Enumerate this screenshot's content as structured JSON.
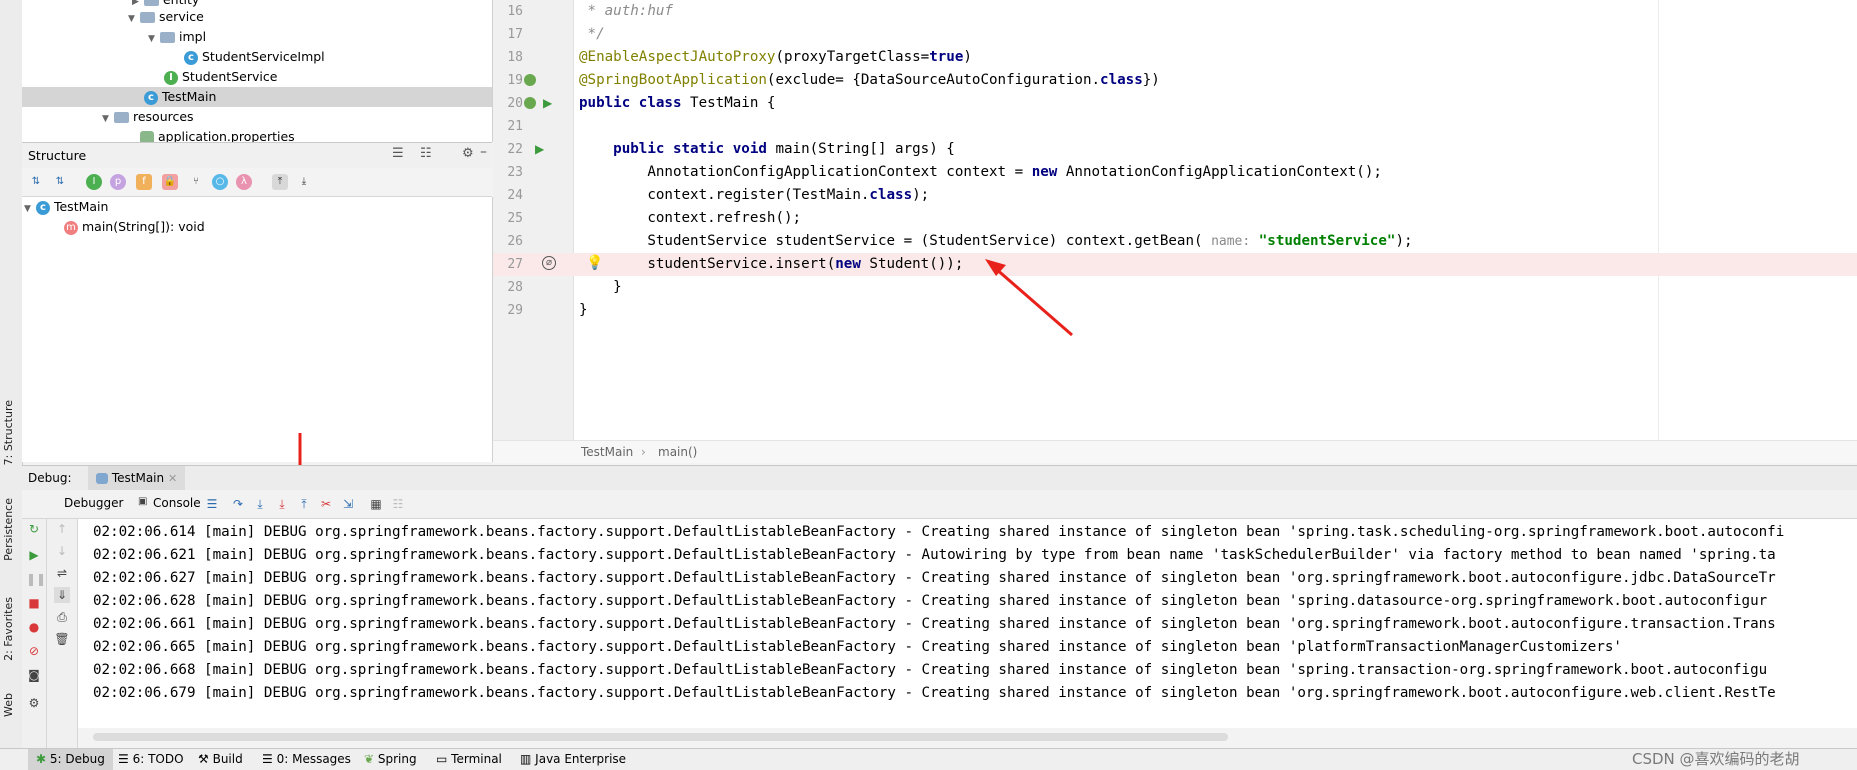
{
  "project_tree": {
    "items": [
      {
        "label": "entity",
        "icon": "folder-icon"
      },
      {
        "label": "service",
        "icon": "folder-icon"
      },
      {
        "label": "impl",
        "icon": "folder-icon"
      },
      {
        "label": "StudentServiceImpl",
        "icon": "class-icon"
      },
      {
        "label": "StudentService",
        "icon": "interface-icon"
      },
      {
        "label": "TestMain",
        "icon": "class-icon"
      },
      {
        "label": "resources",
        "icon": "folder-icon"
      },
      {
        "label": "application.properties",
        "icon": "properties-icon"
      }
    ]
  },
  "structure": {
    "title": "Structure",
    "root": "TestMain",
    "method": "main(String[]): void"
  },
  "editor": {
    "lines": [
      {
        "num": "16",
        "text": " * auth:huf"
      },
      {
        "num": "17",
        "text": " */"
      },
      {
        "num": "18",
        "text": "@EnableAspectJAutoProxy(proxyTargetClass=true)"
      },
      {
        "num": "19",
        "text": "@SpringBootApplication(exclude= {DataSourceAutoConfiguration.class})"
      },
      {
        "num": "20",
        "text": "public class TestMain {"
      },
      {
        "num": "21",
        "text": ""
      },
      {
        "num": "22",
        "text": "    public static void main(String[] args) {"
      },
      {
        "num": "23",
        "text": "        AnnotationConfigApplicationContext context = new AnnotationConfigApplicationContext();"
      },
      {
        "num": "24",
        "text": "        context.register(TestMain.class);"
      },
      {
        "num": "25",
        "text": "        context.refresh();"
      },
      {
        "num": "26",
        "text": "        StudentService studentService = (StudentService) context.getBean( name: \"studentService\");"
      },
      {
        "num": "27",
        "text": "        studentService.insert(new Student());"
      },
      {
        "num": "28",
        "text": "    }"
      },
      {
        "num": "29",
        "text": "}"
      }
    ],
    "breadcrumb": [
      "TestMain",
      "main()"
    ]
  },
  "debug": {
    "label": "Debug:",
    "session_tab": "TestMain",
    "tabs": [
      "Debugger",
      "Console"
    ]
  },
  "console": {
    "lines": [
      "02:02:06.614 [main] DEBUG org.springframework.beans.factory.support.DefaultListableBeanFactory - Creating shared instance of singleton bean 'spring.task.scheduling-org.springframework.boot.autoconfi",
      "02:02:06.621 [main] DEBUG org.springframework.beans.factory.support.DefaultListableBeanFactory - Autowiring by type from bean name 'taskSchedulerBuilder' via factory method to bean named 'spring.ta",
      "02:02:06.627 [main] DEBUG org.springframework.beans.factory.support.DefaultListableBeanFactory - Creating shared instance of singleton bean 'org.springframework.boot.autoconfigure.jdbc.DataSourceTr",
      "02:02:06.628 [main] DEBUG org.springframework.beans.factory.support.DefaultListableBeanFactory - Creating shared instance of singleton bean 'spring.datasource-org.springframework.boot.autoconfigur",
      "02:02:06.661 [main] DEBUG org.springframework.beans.factory.support.DefaultListableBeanFactory - Creating shared instance of singleton bean 'org.springframework.boot.autoconfigure.transaction.Trans",
      "02:02:06.665 [main] DEBUG org.springframework.beans.factory.support.DefaultListableBeanFactory - Creating shared instance of singleton bean 'platformTransactionManagerCustomizers'",
      "02:02:06.668 [main] DEBUG org.springframework.beans.factory.support.DefaultListableBeanFactory - Creating shared instance of singleton bean 'spring.transaction-org.springframework.boot.autoconfigu",
      "02:02:06.679 [main] DEBUG org.springframework.beans.factory.support.DefaultListableBeanFactory - Creating shared instance of singleton bean 'org.springframework.boot.autoconfigure.web.client.RestTe"
    ]
  },
  "left_tabs": [
    "7: Structure",
    "Persistence",
    "2: Favorites",
    "Web"
  ],
  "status_bar": {
    "tabs": [
      "5: Debug",
      "6: TODO",
      "Build",
      "0: Messages",
      "Spring",
      "Terminal",
      "Java Enterprise"
    ],
    "watermark": "CSDN @喜欢编码的老胡"
  },
  "colors": {
    "annotation": "#808000",
    "keyword": "#000080",
    "string": "#008000",
    "highlight_line": "#fbe9e9",
    "arrow": "#e8221b"
  }
}
